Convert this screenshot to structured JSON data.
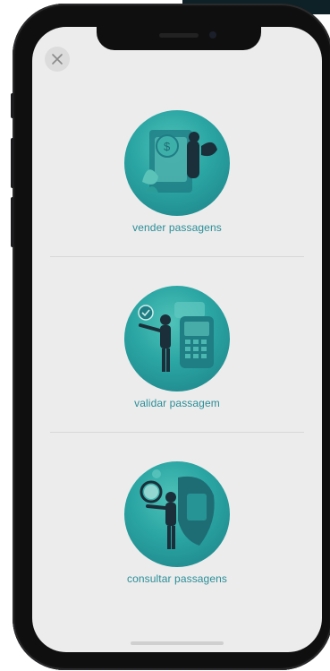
{
  "options": [
    {
      "label": "vender passagens",
      "icon": "ticket-sale-illustration-icon"
    },
    {
      "label": "validar passagem",
      "icon": "ticket-validation-illustration-icon"
    },
    {
      "label": "consultar passagens",
      "icon": "ticket-search-illustration-icon"
    }
  ],
  "colors": {
    "accent": "#2a8e98",
    "screen_bg": "#ececec",
    "circle": "#2aa5a3"
  }
}
